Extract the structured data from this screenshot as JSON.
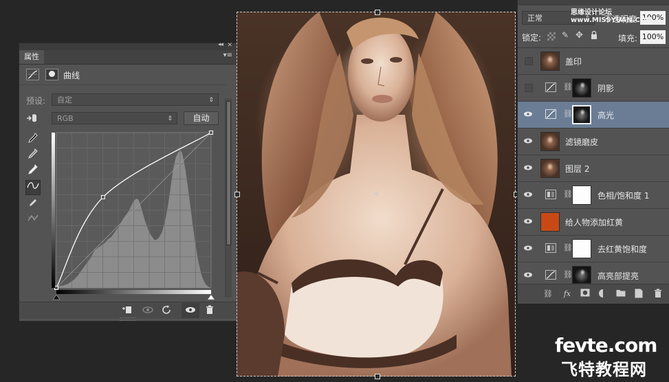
{
  "properties_panel": {
    "tab_label": "属性",
    "collapse_glyph": "◂◂",
    "close_glyph": "✕",
    "menu_glyph": "▾≡",
    "adjustment_title": "曲线",
    "preset_label": "预设:",
    "preset_value": "自定",
    "channel_value": "RGB",
    "auto_button": "自动",
    "tools": [
      "sample-in-image-icon",
      "eyedropper-black-icon",
      "eyedropper-gray-icon",
      "eyedropper-white-icon",
      "curve-points-icon",
      "pencil-icon",
      "smooth-icon"
    ],
    "bottom_icons": [
      "clip-to-layer-icon",
      "view-previous-icon",
      "reset-icon",
      "visibility-icon",
      "trash-icon"
    ]
  },
  "curve": {
    "input_range": [
      0,
      255
    ],
    "output_range": [
      0,
      255
    ],
    "control_points": [
      [
        0,
        0
      ],
      [
        77,
        149
      ],
      [
        255,
        255
      ]
    ]
  },
  "layers_panel": {
    "blend_mode": "正常",
    "opacity_label": "不透明度:",
    "opacity_value": "100%",
    "lock_label": "锁定:",
    "fill_label": "填充:",
    "fill_value": "100%",
    "layers": [
      {
        "name": "盖印",
        "visible": false,
        "type": "pixel",
        "thumb": "photo"
      },
      {
        "name": "阴影",
        "visible": false,
        "type": "curves",
        "thumb": "bw"
      },
      {
        "name": "高光",
        "visible": true,
        "type": "curves",
        "thumb": "bw",
        "selected": true
      },
      {
        "name": "滤镜磨皮",
        "visible": true,
        "type": "pixel",
        "thumb": "photo"
      },
      {
        "name": "图层 2",
        "visible": true,
        "type": "pixel",
        "thumb": "photo"
      },
      {
        "name": "色相/饱和度 1",
        "visible": true,
        "type": "hue-saturation",
        "thumb": "white"
      },
      {
        "name": "给人物添加红黄",
        "visible": true,
        "type": "fill",
        "thumb": "orange",
        "color": "#c74a16"
      },
      {
        "name": "去红黄饱和度",
        "visible": true,
        "type": "hue-saturation",
        "thumb": "white"
      },
      {
        "name": "高亮部提亮",
        "visible": true,
        "type": "curves",
        "thumb": "bw"
      }
    ],
    "footer_icons": [
      "link-icon",
      "fx-icon",
      "add-mask-icon",
      "adjustment-icon",
      "group-icon",
      "new-layer-icon",
      "trash-icon"
    ]
  },
  "watermark": {
    "line1": "fevte.com",
    "line2": "飞特教程网",
    "top_text": "思缘设计论坛 www.MISSYUAN.COM"
  },
  "colors": {
    "panel_bg": "#535353",
    "app_bg": "#262626",
    "selected_row": "#6a7d95",
    "fill_layer": "#c74a16"
  }
}
